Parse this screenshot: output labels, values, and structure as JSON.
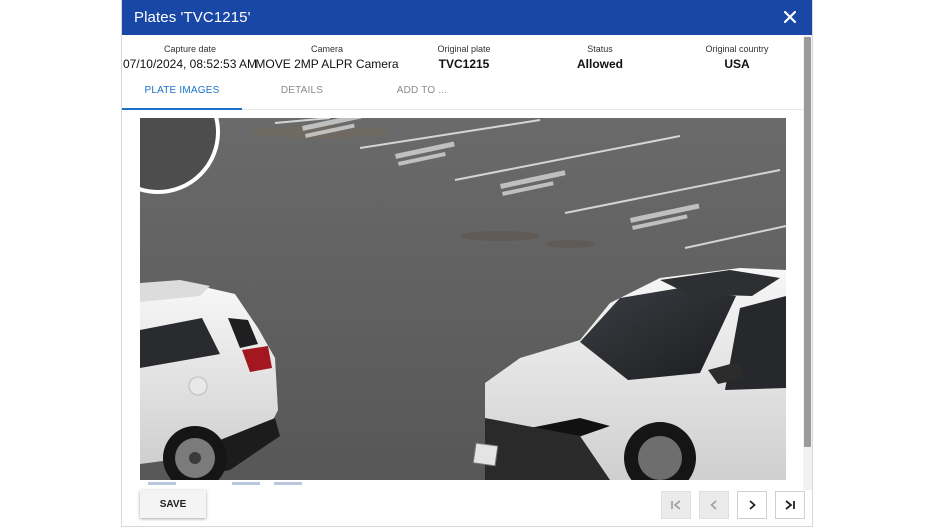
{
  "dialog": {
    "title": "Plates 'TVC1215'",
    "close_icon": "close-icon"
  },
  "info": [
    {
      "label": "Capture date",
      "value": "07/10/2024, 08:52:53 AM"
    },
    {
      "label": "Camera",
      "value": "MOVE 2MP ALPR Camera"
    },
    {
      "label": "Original plate",
      "value": "TVC1215"
    },
    {
      "label": "Status",
      "value": "Allowed"
    },
    {
      "label": "Original country",
      "value": "USA"
    }
  ],
  "tabs": [
    {
      "label": "PLATE IMAGES",
      "active": true
    },
    {
      "label": "DETAILS",
      "active": false
    },
    {
      "label": "ADD TO ...",
      "active": false
    }
  ],
  "footer": {
    "save_label": "SAVE",
    "nav": [
      {
        "icon": "first-page-icon",
        "enabled": false
      },
      {
        "icon": "previous-icon",
        "enabled": false
      },
      {
        "icon": "next-icon",
        "enabled": true
      },
      {
        "icon": "last-page-icon",
        "enabled": true
      }
    ]
  },
  "colors": {
    "titlebar": "#1847a6",
    "active_tab": "#1a73c9"
  }
}
